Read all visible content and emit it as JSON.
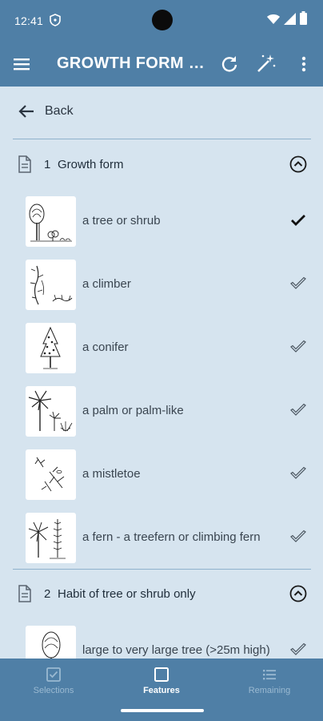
{
  "status_bar": {
    "time": "12:41"
  },
  "app_bar": {
    "title": "GROWTH FORM &..."
  },
  "back": {
    "label": "Back"
  },
  "sections": [
    {
      "number": "1",
      "title": "Growth form",
      "states": [
        {
          "label": "a tree or shrub",
          "check": "solid-check-icon"
        },
        {
          "label": "a climber",
          "check": "outline-check-icon"
        },
        {
          "label": "a conifer",
          "check": "outline-check-icon"
        },
        {
          "label": "a palm or palm-like",
          "check": "outline-check-icon"
        },
        {
          "label": "a mistletoe",
          "check": "outline-check-icon"
        },
        {
          "label": "a fern - a  treefern or climbing fern",
          "check": "outline-check-icon"
        }
      ]
    },
    {
      "number": "2",
      "title": "Habit of tree or shrub only",
      "states": [
        {
          "label": "large to very large tree (>25m high)",
          "check": "outline-check-icon"
        }
      ]
    }
  ],
  "bottom_nav": {
    "items": [
      {
        "label": "Selections",
        "icon": "checkbox-icon",
        "active": false
      },
      {
        "label": "Features",
        "icon": "square-icon",
        "active": true
      },
      {
        "label": "Remaining",
        "icon": "list-icon",
        "active": false
      }
    ]
  },
  "colors": {
    "app_bar": "#4f7fa6",
    "background": "#d6e4ef",
    "divider": "#8fb2cc"
  }
}
